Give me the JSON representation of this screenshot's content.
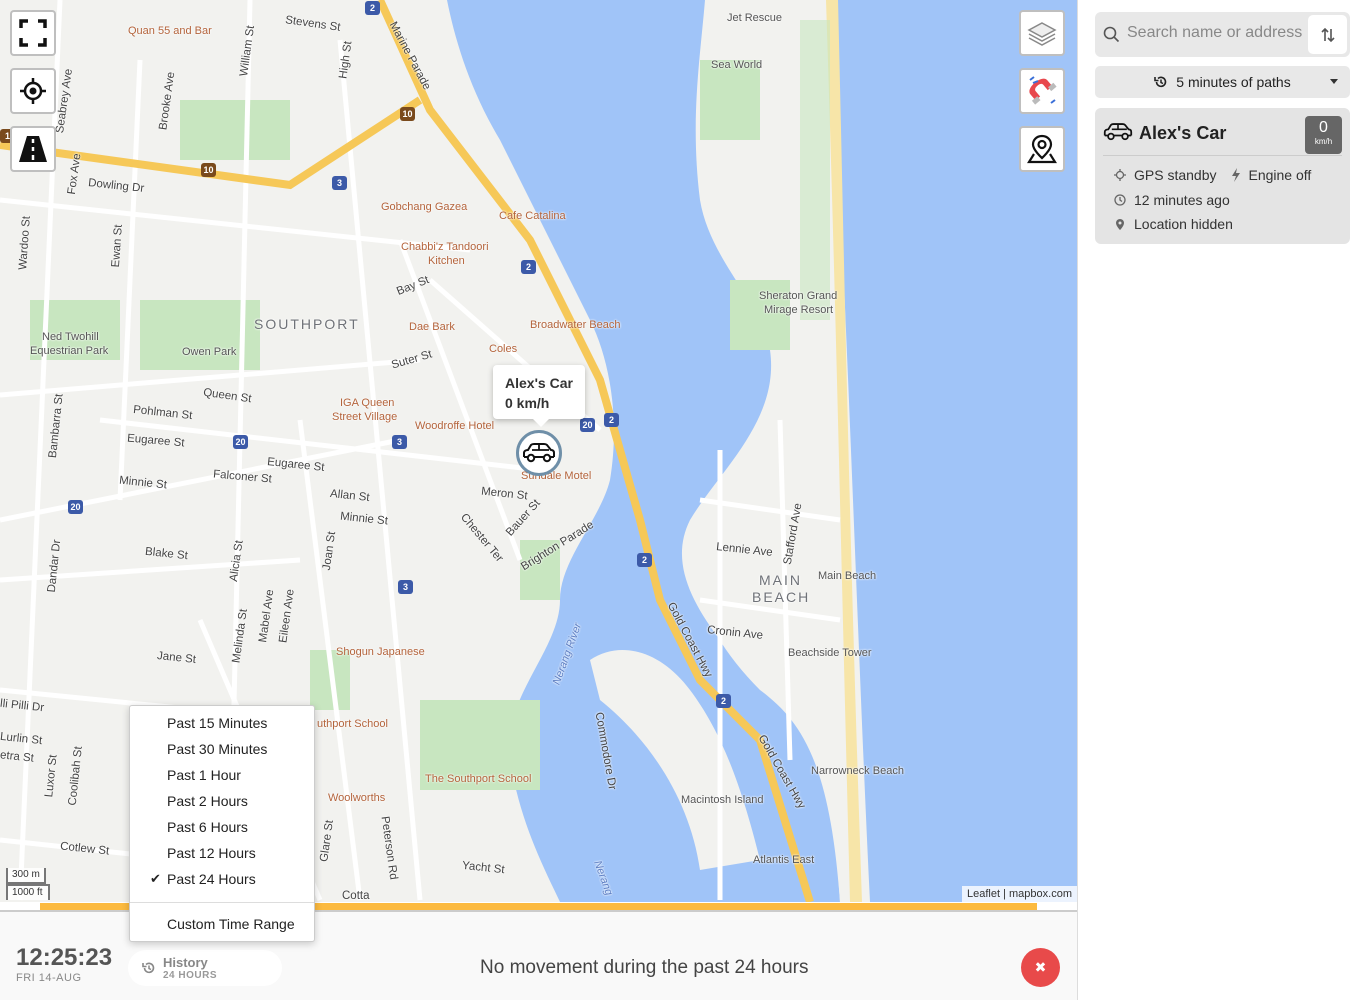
{
  "map": {
    "labels": {
      "suburb_southport": "SOUTHPORT",
      "suburb_main_beach_1": "MAIN",
      "suburb_main_beach_2": "BEACH",
      "poi_quan": "Quan 55 and Bar",
      "poi_gobchang": "Gobchang Gazea",
      "poi_cafe_catalina": "Cafe Catalina",
      "poi_chabbiz_1": "Chabbi'z Tandoori",
      "poi_chabbiz_2": "Kitchen",
      "poi_dae_bark": "Dae Bark",
      "poi_coles": "Coles",
      "poi_broadwater": "Broadwater Beach",
      "poi_iga_1": "IGA Queen",
      "poi_iga_2": "Street Village",
      "poi_woodroffe": "Woodroffe Hotel",
      "poi_sundale": "Sundale Motel",
      "poi_shogun": "Shogun Japanese",
      "poi_southport_school_a": "uthport School",
      "poi_southport_school_b": "The Southport School",
      "poi_woolworths": "Woolworths",
      "poi_jet_rescue": "Jet Rescue",
      "poi_sea_world": "Sea World",
      "poi_sheraton_1": "Sheraton Grand",
      "poi_sheraton_2": "Mirage Resort",
      "poi_main_beach": "Main Beach",
      "poi_beachside": "Beachside Tower",
      "poi_narrowneck": "Narrowneck Beach",
      "poi_macintosh": "Macintosh Island",
      "poi_atlantis": "Atlantis East",
      "poi_ned_1": "Ned Twohill",
      "poi_ned_2": "Equestrian Park",
      "poi_owen": "Owen Park",
      "road_stevens": "Stevens St",
      "road_marine": "Marine Parade",
      "road_william": "William St",
      "road_high": "High St",
      "road_brooke": "Brooke Ave",
      "road_seabrey": "Seabrey Ave",
      "road_dowling": "Dowling Dr",
      "road_fox": "Fox Ave",
      "road_wardoo": "Wardoo St",
      "road_ewan": "Ewan St",
      "road_bay": "Bay St",
      "road_suter": "Suter St",
      "road_queen": "Queen St",
      "road_pohlman": "Pohlman St",
      "road_eugaree_1": "Eugaree St",
      "road_eugaree_2": "Eugaree St",
      "road_bambarra": "Bambarra St",
      "road_minnie_1": "Minnie St",
      "road_minnie_2": "Minnie St",
      "road_falconer": "Falconer St",
      "road_allan": "Allan St",
      "road_meron": "Meron St",
      "road_bauer": "Bauer St",
      "road_chester": "Chester Ter",
      "road_brighton": "Brighton Parade",
      "road_blake": "Blake St",
      "road_dandar": "Dandar Dr",
      "road_alicia": "Alicia St",
      "road_joan": "Joan St",
      "road_jane": "Jane St",
      "road_melinda": "Melinda St",
      "road_mabel": "Mabel Ave",
      "road_eileen": "Eileen Ave",
      "road_pilli": "lli Pilli Dr",
      "road_lurlin": "Lurlin St",
      "road_etra": "etra St",
      "road_luxor": "Luxor St",
      "road_coolibah": "Coolibah St",
      "road_cotlew": "Cotlew St",
      "road_glare": "Glare St",
      "road_peterson": "Peterson Rd",
      "road_yacht": "Yacht St",
      "road_gold_coast_1": "Gold Coast Hwy",
      "road_gold_coast_2": "Gold Coast Hwy",
      "road_commodore": "Commodore Dr",
      "road_lennie": "Lennie Ave",
      "road_stafford": "Stafford Ave",
      "road_cronin": "Cronin Ave",
      "road_cotta": "Cotta",
      "water_nerang": "Nerang River",
      "water_nerang_2": "Nerang"
    },
    "shields": [
      "2",
      "10",
      "10",
      "3",
      "2",
      "20",
      "3",
      "2",
      "20",
      "20",
      "3",
      "2",
      "2",
      "1"
    ],
    "popup_name": "Alex's Car",
    "popup_speed": "0 km/h",
    "scale_metric": "300 m",
    "scale_imperial": "1000 ft",
    "attribution_leaflet": "Leaflet",
    "attribution_sep": " | ",
    "attribution_mapbox": "mapbox.com"
  },
  "panel": {
    "search_placeholder": "Search name or address",
    "paths_label": "5 minutes of paths",
    "vehicle": {
      "name": "Alex's Car",
      "speed_value": "0",
      "speed_unit": "km/h",
      "gps_status": "GPS standby",
      "engine_status": "Engine off",
      "last_seen": "12 minutes ago",
      "location": "Location hidden"
    }
  },
  "bottom": {
    "time": "12:25:23",
    "date": "FRI 14-AUG",
    "history_title": "History",
    "history_sub": "24 HOURS",
    "message": "No movement during the past 24 hours",
    "close_symbol": "✖"
  },
  "menu": {
    "items": [
      "Past 15 Minutes",
      "Past 30 Minutes",
      "Past 1 Hour",
      "Past 2 Hours",
      "Past 6 Hours",
      "Past 12 Hours",
      "Past 24 Hours"
    ],
    "selected_index": 6,
    "check_symbol": "✔",
    "custom": "Custom Time Range"
  },
  "colors": {
    "water": "#a0c4f8",
    "park": "#c8e6c0",
    "highway": "#f6c858",
    "progress": "#fcba3f",
    "close": "#e84a4a"
  }
}
